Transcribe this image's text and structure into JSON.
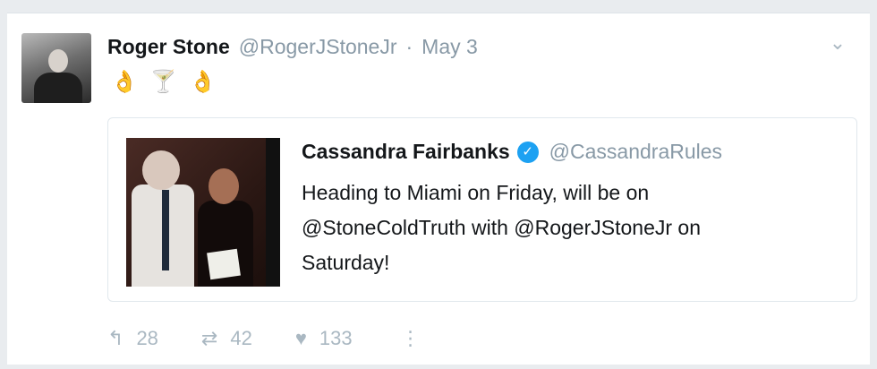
{
  "tweet": {
    "author_name": "Roger Stone",
    "author_handle": "@RogerJStoneJr",
    "separator": "·",
    "date": "May 3",
    "emojis": [
      "👌",
      "🍸",
      "👌"
    ],
    "quote": {
      "name": "Cassandra Fairbanks",
      "handle": "@CassandraRules",
      "text_lines": [
        "Heading to Miami on Friday, will be on",
        "@StoneColdTruth with @RogerJStoneJr on",
        "Saturday!"
      ]
    },
    "actions": {
      "reply_count": "28",
      "retweet_count": "42",
      "like_count": "133"
    }
  },
  "icons": {
    "chevron": "chevron-down-icon",
    "reply": "reply-icon",
    "retweet": "retweet-icon",
    "like": "heart-icon",
    "more": "more-icon",
    "verified": "verified-badge-icon"
  },
  "colors": {
    "name": "#14171a",
    "muted": "#8899a6",
    "icon": "#aab8c2",
    "verified": "#1da1f2"
  }
}
